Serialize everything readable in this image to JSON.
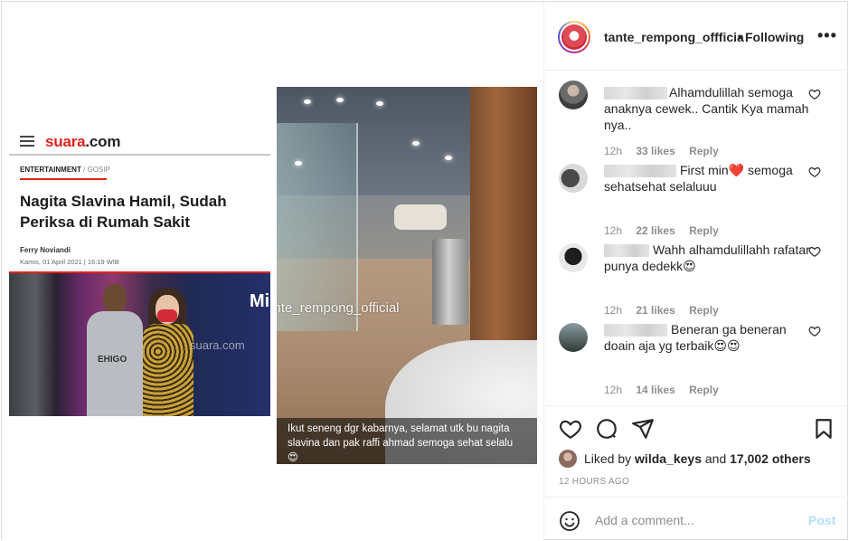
{
  "media": {
    "article": {
      "brand_part1": "suara",
      "brand_part2": ".com",
      "category": "ENTERTAINMENT",
      "category_sub": " / GOSIP",
      "headline": "Nagita Slavina Hamil, Sudah Periksa di Rumah Sakit",
      "author": "Ferry Noviandi",
      "date": "Kamis, 01 April 2021 | 16:19 WIB",
      "photo_watermark": "suara.com",
      "photo_shirt_text": "EHIGO",
      "photo_banner_text": "Mi"
    },
    "video": {
      "watermark": "tante_rempong_official",
      "caption": "Ikut seneng dgr kabarnya, selamat utk bu nagita slavina dan pak raffi ahmad semoga sehat selalu 😍"
    }
  },
  "header": {
    "username": "tante_rempong_offficia",
    "separator": "•",
    "follow_status": "Following",
    "more_icon": "more-horizontal-icon"
  },
  "comments": [
    {
      "text": "Alhamdulillah semoga anaknya cewek.. Cantik Kya mamah nya..",
      "time": "12h",
      "likes": "33 likes",
      "reply": "Reply"
    },
    {
      "text": "First min❤️ semoga sehatsehat selaluuu",
      "time": "12h",
      "likes": "22 likes",
      "reply": "Reply"
    },
    {
      "text": "Wahh alhamdulillahh rafatar punya dedekk😍",
      "time": "12h",
      "likes": "21 likes",
      "reply": "Reply"
    },
    {
      "text": "Beneran ga beneran doain aja yg terbaik😍😍",
      "time": "12h",
      "likes": "14 likes",
      "reply": "Reply"
    }
  ],
  "actions": {
    "liked_by_prefix": "Liked by ",
    "liked_by_user": "wilda_keys",
    "liked_by_and": " and ",
    "liked_by_others": "17,002 others",
    "time_ago": "12 HOURS AGO"
  },
  "add_comment": {
    "placeholder": "Add a comment...",
    "post_label": "Post"
  },
  "colors": {
    "brand_red": "#e2231a",
    "text_primary": "#262626",
    "text_secondary": "#8e8e8e",
    "post_disabled": "#b2dffc",
    "heart_red": "#ed4956"
  }
}
